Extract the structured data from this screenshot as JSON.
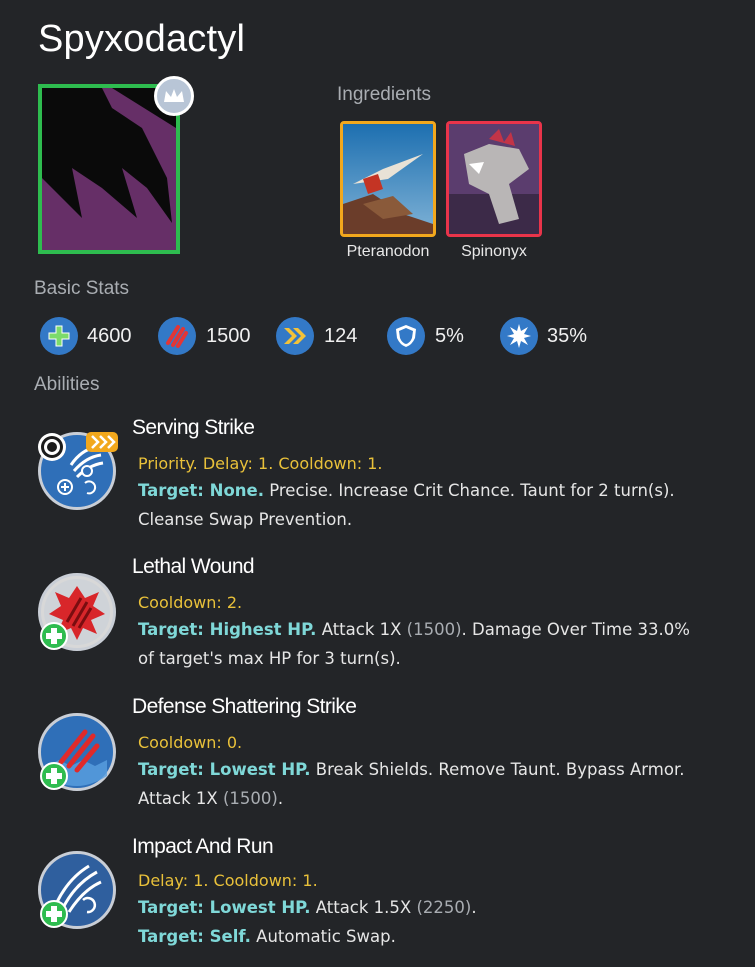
{
  "title": "Spyxodactyl",
  "ingredients": {
    "label": "Ingredients",
    "items": [
      {
        "name": "Pteranodon",
        "rarity_color": "#f2a81d"
      },
      {
        "name": "Spinonyx",
        "rarity_color": "#e9344a"
      }
    ]
  },
  "rarity_color": "#2ebc4f",
  "basic_stats": {
    "label": "Basic Stats",
    "health": "4600",
    "damage": "1500",
    "speed": "124",
    "armor": "5%",
    "crit": "35%"
  },
  "abilities": {
    "label": "Abilities",
    "items": [
      {
        "name": "Serving Strike",
        "meta": "Priority. Delay: 1. Cooldown: 1.",
        "target": "Target: None.",
        "line1": " Precise. Increase Crit Chance. Taunt for 2 turn(s).",
        "line2": "Cleanse Swap Prevention."
      },
      {
        "name": "Lethal Wound",
        "meta": "Cooldown: 2.",
        "target": "Target: Highest HP.",
        "line1a": " Attack 1X ",
        "dmg": "(1500)",
        "line1b": ". Damage Over Time 33.0%",
        "line2": "of target's max HP for 3 turn(s)."
      },
      {
        "name": "Defense Shattering Strike",
        "meta": "Cooldown: 0.",
        "target": "Target: Lowest HP.",
        "line1": " Break Shields. Remove Taunt. Bypass Armor.",
        "line2a": "Attack 1X ",
        "dmg": "(1500)",
        "line2b": "."
      },
      {
        "name": "Impact And Run",
        "meta": "Delay: 1. Cooldown: 1.",
        "target": "Target: Lowest HP.",
        "line1a": " Attack 1.5X ",
        "dmg": "(2250)",
        "line1b": ".",
        "target2": "Target: Self.",
        "line2": " Automatic Swap."
      }
    ]
  }
}
